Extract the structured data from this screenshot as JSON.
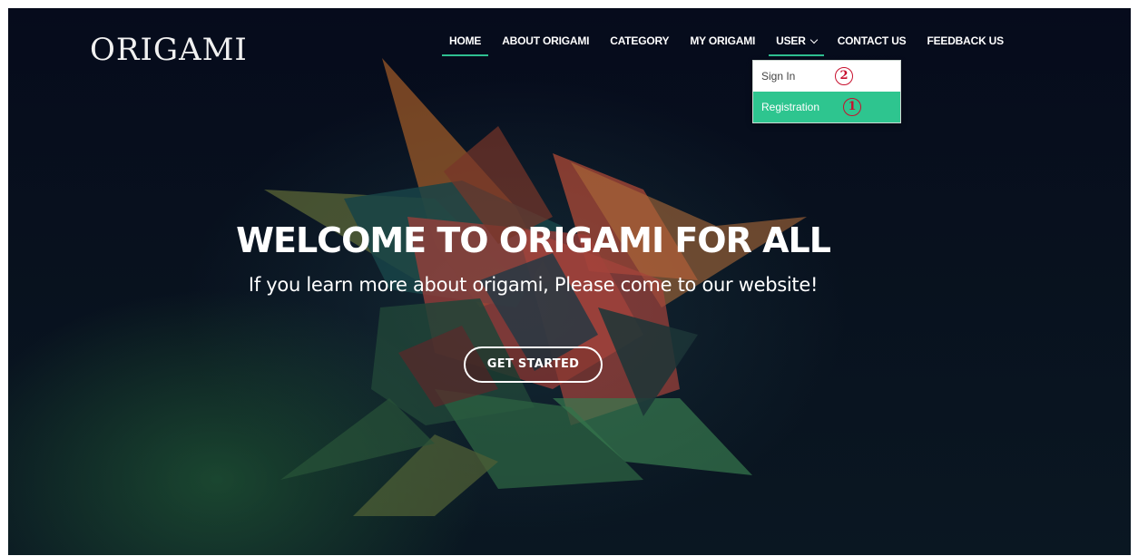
{
  "brand": {
    "logo_text": "ORIGAMI"
  },
  "nav": {
    "items": [
      {
        "label": "HOME",
        "active": true
      },
      {
        "label": "ABOUT ORIGAMI"
      },
      {
        "label": "CATEGORY"
      },
      {
        "label": "MY ORIGAMI"
      },
      {
        "label": "USER",
        "has_dropdown": true,
        "open": true
      },
      {
        "label": "CONTACT US"
      },
      {
        "label": "FEEDBACK US"
      }
    ]
  },
  "user_dropdown": {
    "items": [
      {
        "label": "Sign In",
        "annotation": "2",
        "highlighted": false
      },
      {
        "label": "Registration",
        "annotation": "1",
        "highlighted": true
      }
    ]
  },
  "hero": {
    "title": "WELCOME TO ORIGAMI FOR ALL",
    "subtitle": "If you learn more about origami, Please come to our website!",
    "cta_label": "GET STARTED"
  },
  "colors": {
    "accent": "#2ec58f",
    "annotation_red": "#c8102e",
    "background": "#08111e"
  },
  "icons": {
    "dropdown": "chevron-down-icon"
  }
}
